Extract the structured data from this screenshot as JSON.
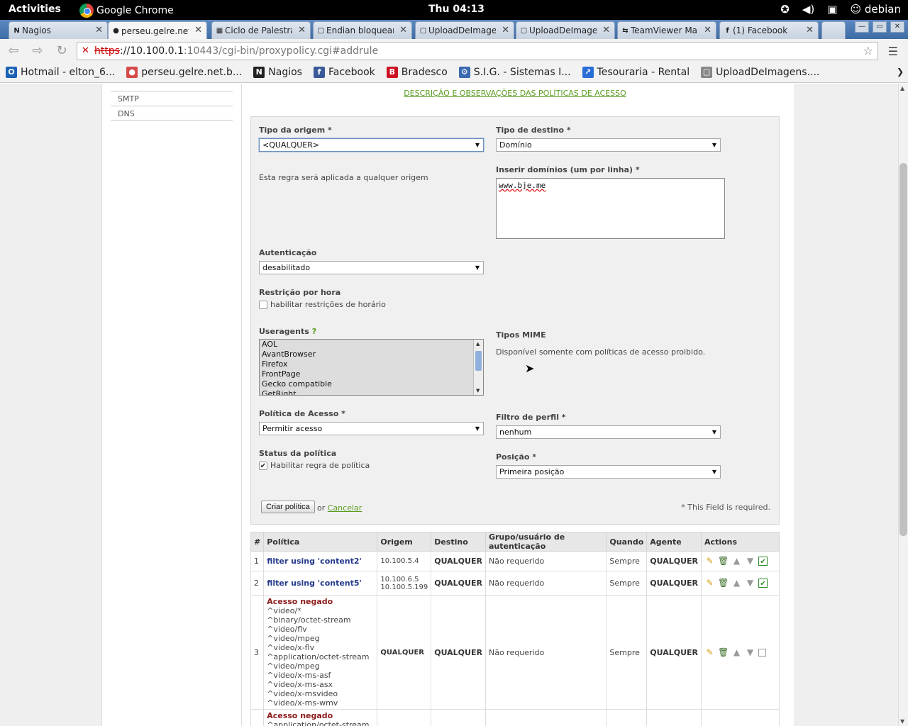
{
  "topbar": {
    "activities": "Activities",
    "app": "Google Chrome",
    "clock": "Thu 04:13",
    "user": "debian"
  },
  "tabs": [
    {
      "label": "Nagios",
      "fav": "N"
    },
    {
      "label": "perseu.gelre.net.",
      "fav": "●",
      "active": true
    },
    {
      "label": "Ciclo de Palestra",
      "fav": "▦"
    },
    {
      "label": "Endian bloqueand",
      "fav": "▢"
    },
    {
      "label": "UploadDeImagen",
      "fav": "▢"
    },
    {
      "label": "UploadDeImagen",
      "fav": "▢"
    },
    {
      "label": "TeamViewer Mar",
      "fav": "⇆"
    },
    {
      "label": "(1) Facebook",
      "fav": "f"
    }
  ],
  "omnibox": {
    "scheme": "https",
    "host": "://10.100.0.1",
    "path": ":10443/cgi-bin/proxypolicy.cgi#addrule"
  },
  "bookmarks": [
    {
      "label": "Hotmail - elton_6...",
      "icon": "O",
      "color": "#1a62b5"
    },
    {
      "label": "perseu.gelre.net.b...",
      "icon": "●",
      "color": "#d64a4a"
    },
    {
      "label": "Nagios",
      "icon": "N",
      "color": "#222"
    },
    {
      "label": "Facebook",
      "icon": "f",
      "color": "#3b5998"
    },
    {
      "label": "Bradesco",
      "icon": "B",
      "color": "#cc1122"
    },
    {
      "label": "S.I.G. - Sistemas I...",
      "icon": "⚙",
      "color": "#3a6ab0"
    },
    {
      "label": "Tesouraria - Rental",
      "icon": "↗",
      "color": "#2a6fd6"
    },
    {
      "label": "UploadDeImagens....",
      "icon": "▢",
      "color": "#888"
    }
  ],
  "sidemenu": [
    "SMTP",
    "DNS"
  ],
  "desc_link": "DESCRIÇÃO E OBSERVAÇÕES DAS POLÍTICAS DE ACESSO",
  "form": {
    "origem_label": "Tipo da origem *",
    "origem_value": "<QUALQUER>",
    "origem_note": "Esta regra será aplicada a qualquer origem",
    "destino_label": "Tipo de destino *",
    "destino_value": "Domínio",
    "dominios_label": "Inserir domínios (um por linha) *",
    "dominios_value": "www.bje.me",
    "auth_label": "Autenticação",
    "auth_value": "desabilitado",
    "hora_label": "Restrição por hora",
    "hora_check": "habilitar restrições de horário",
    "useragents_label": "Useragents",
    "useragents_help": "?",
    "useragents": [
      "AOL",
      "AvantBrowser",
      "Firefox",
      "FrontPage",
      "Gecko compatible",
      "GetRight"
    ],
    "mime_label": "Tipos MIME",
    "mime_note": "Disponível somente com políticas de acesso proibido.",
    "politica_label": "Política de Acesso *",
    "politica_value": "Permitir acesso",
    "filtro_label": "Filtro de perfil *",
    "filtro_value": "nenhum",
    "status_label": "Status da política",
    "status_check": "Habilitar regra de política",
    "posicao_label": "Posição *",
    "posicao_value": "Primeira posição",
    "create_button": "Criar política",
    "or": "or",
    "cancel": "Cancelar",
    "required_note": "* This Field is required."
  },
  "table": {
    "headers": [
      "#",
      "Política",
      "Origem",
      "Destino",
      "Grupo/usuário de autenticação",
      "Quando",
      "Agente",
      "Actions"
    ],
    "rows": [
      {
        "n": "1",
        "policy": "filter using 'content2'",
        "origem": [
          "10.100.5.4"
        ],
        "destino": "QUALQUER",
        "grupo": "Não requerido",
        "quando": "Sempre",
        "agente": "QUALQUER",
        "enabled": true
      },
      {
        "n": "2",
        "policy": "filter using 'content5'",
        "origem": [
          "10.100.6.5",
          "10.100.5.199"
        ],
        "destino": "QUALQUER",
        "grupo": "Não requerido",
        "quando": "Sempre",
        "agente": "QUALQUER",
        "enabled": true
      },
      {
        "n": "3",
        "policy": "Acesso negado",
        "deny": true,
        "mime": [
          "^video/*",
          "^binary/octet-stream",
          "^video/flv",
          "^video/mpeg",
          "^video/x-flv",
          "^application/octet-stream",
          "^video/mpeg",
          "^video/x-ms-asf",
          "^video/x-ms-asx",
          "^video/x-msvideo",
          "^video/x-ms-wmv"
        ],
        "origem": [
          "QUALQUER"
        ],
        "destino": "QUALQUER",
        "grupo": "Não requerido",
        "quando": "Sempre",
        "agente": "QUALQUER",
        "enabled": false
      },
      {
        "n": "",
        "policy": "Acesso negado",
        "deny": true,
        "mime": [
          "^application/octet-stream"
        ],
        "origem": [
          ""
        ],
        "destino": "",
        "grupo": "",
        "quando": "",
        "agente": "",
        "enabled": null
      }
    ]
  }
}
